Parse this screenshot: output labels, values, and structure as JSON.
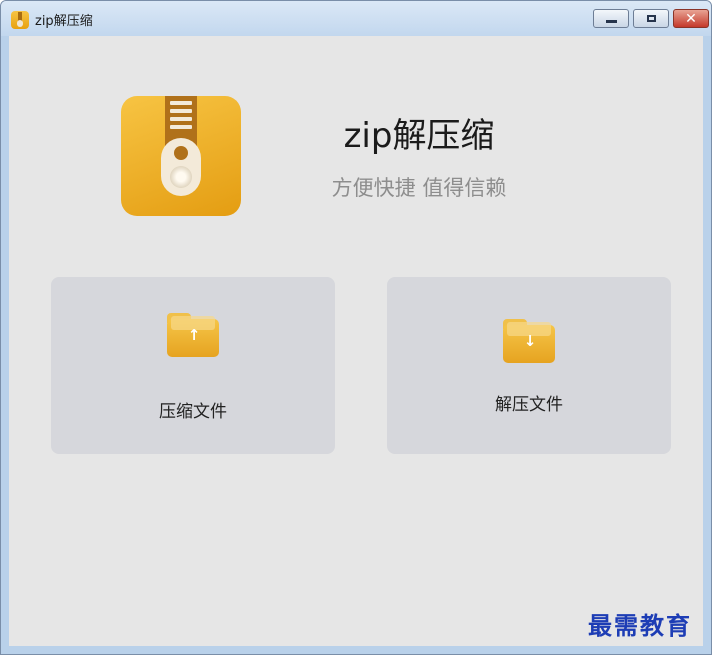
{
  "window": {
    "title": "zip解压缩",
    "controls": {
      "minimize_icon": "minimize-icon",
      "maximize_icon": "maximize-icon",
      "close_icon": "close-icon"
    }
  },
  "header": {
    "app_name": "zip解压缩",
    "tagline": "方便快捷 值得信赖",
    "icon": "zip-archive-icon",
    "brand_color": "#F0B02A"
  },
  "actions": {
    "compress": {
      "label": "压缩文件",
      "icon": "folder-upload-icon"
    },
    "extract": {
      "label": "解压文件",
      "icon": "folder-download-icon"
    }
  },
  "watermark": {
    "text": "最需教育",
    "color": "#1D3DB5"
  }
}
